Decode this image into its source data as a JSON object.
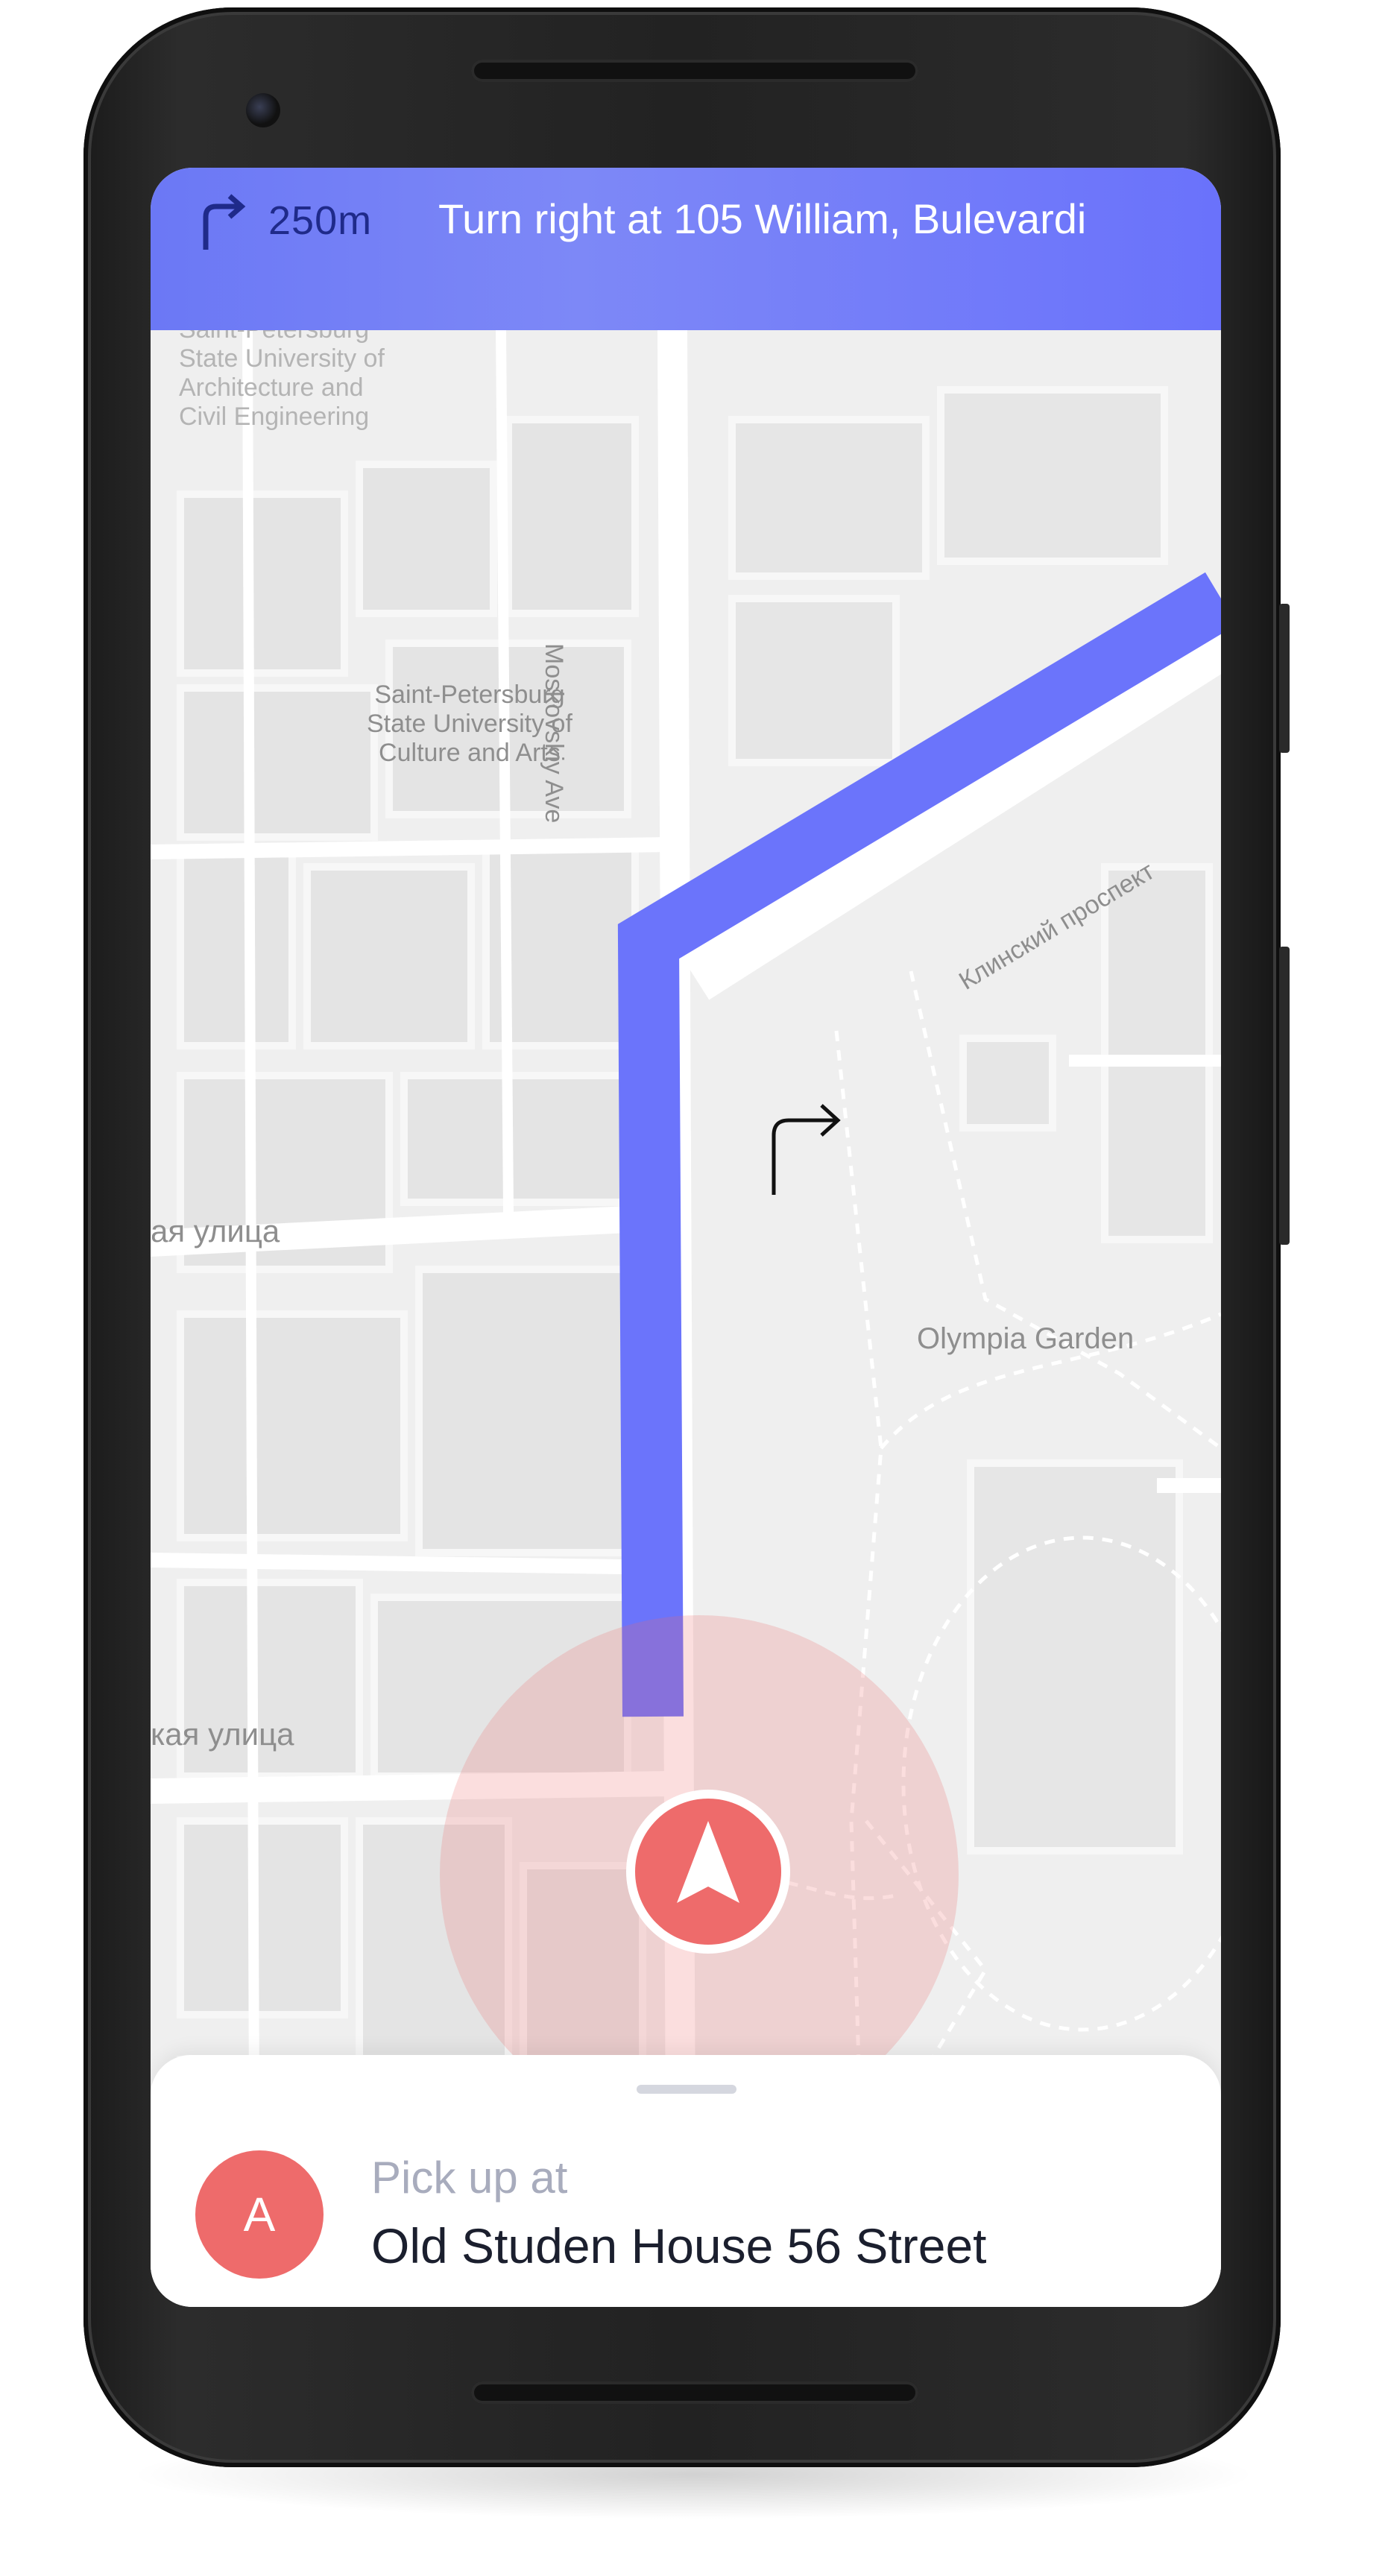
{
  "navigation": {
    "distance": "250m",
    "instruction": "Turn right at 105 William, Bulevardi",
    "turn_icon": "turn-right-icon"
  },
  "map": {
    "labels": {
      "university_top": "Saint-Petersburg\nState University of\nArchitecture and\nCivil Engineering",
      "university_culture": "Saint-Petersburg\nState University of\nCulture and Arts",
      "moskovsky_ave": "Moskovskiy Ave",
      "klinsky": "Клинский проспект",
      "street_1": "ая улица",
      "street_2": "кая улица",
      "olympia_garden": "Olympia Garden"
    },
    "route_color": "#6b74fb",
    "position_marker": "navigation-arrow-icon",
    "turn_marker": "turn-right-arrow-icon"
  },
  "pickup": {
    "avatar_letter": "A",
    "label": "Pick up at",
    "address": "Old Studen House 56 Street",
    "avatar_color": "#ee6b6b"
  }
}
